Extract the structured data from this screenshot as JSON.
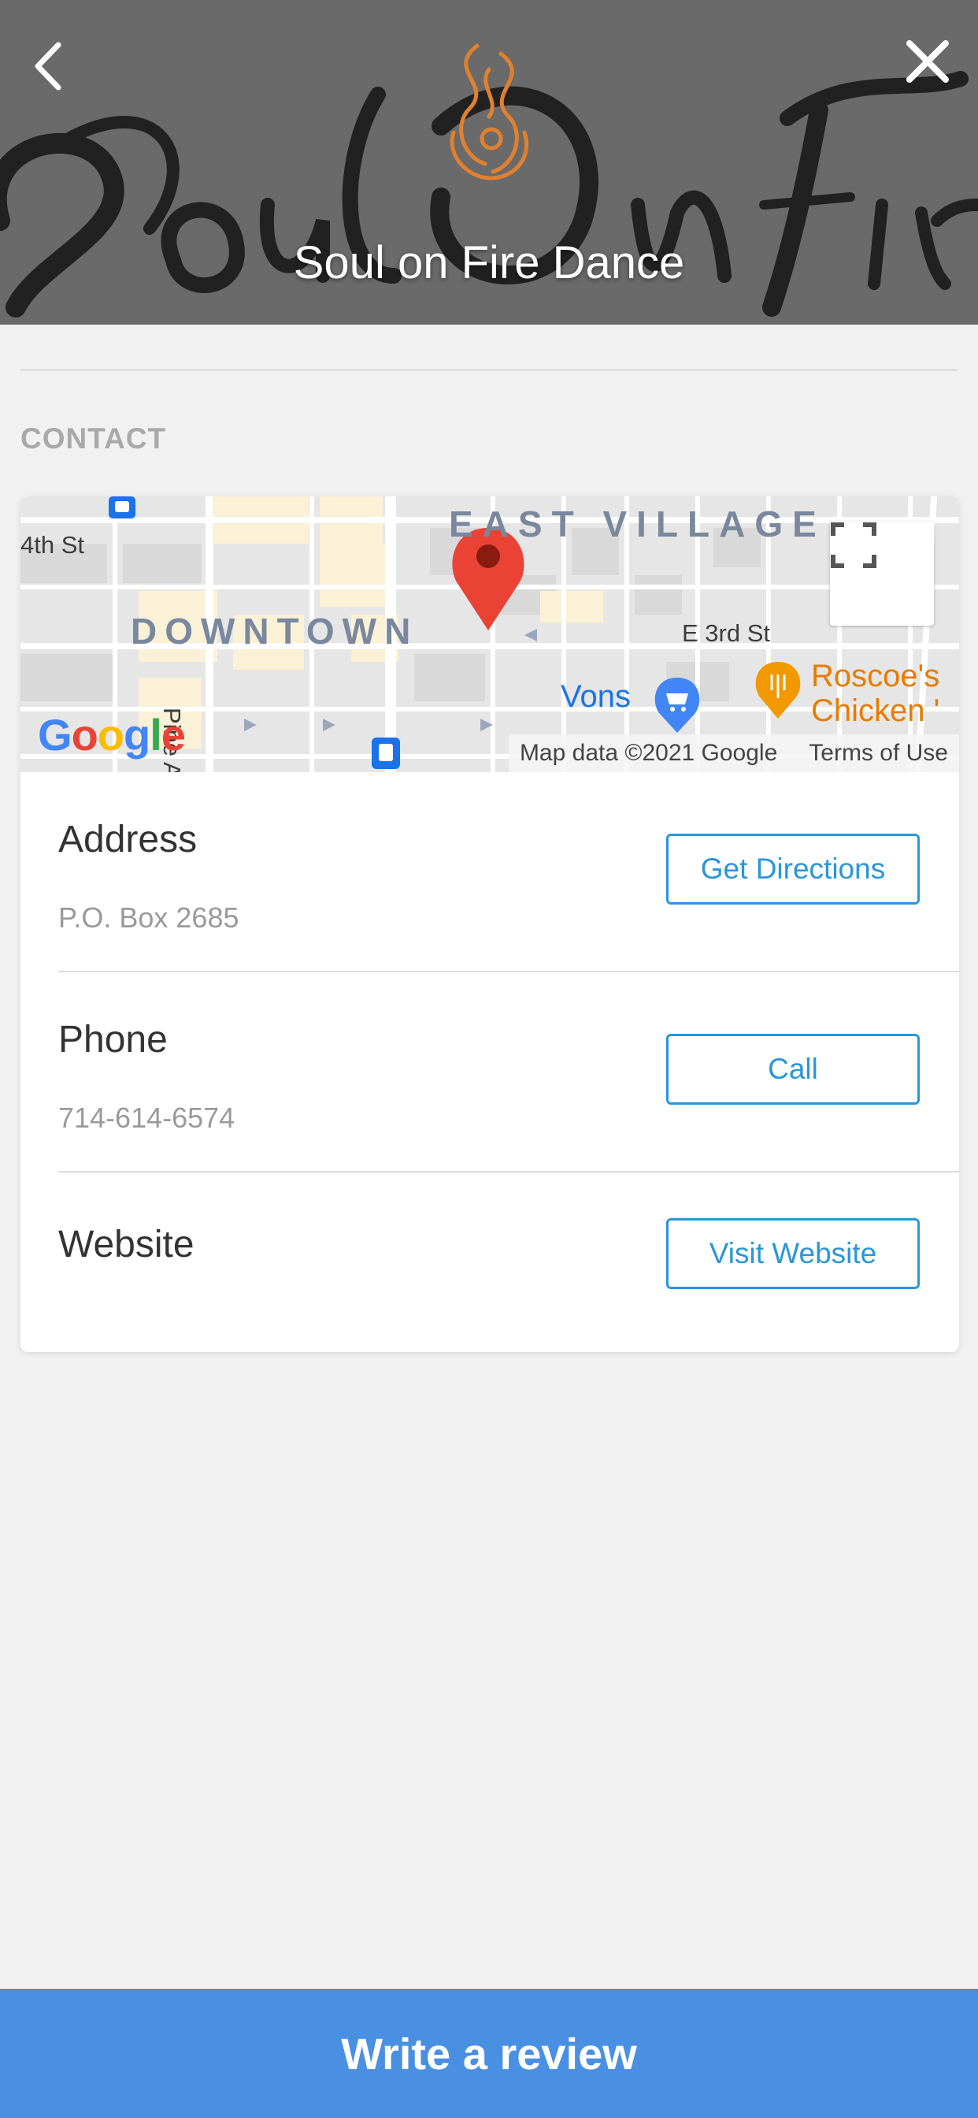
{
  "header": {
    "title": "Soul on Fire Dance",
    "back_icon": "chevron-left-icon",
    "close_icon": "close-icon",
    "logo": "flame-logo",
    "background_script": "Soul On Fire"
  },
  "contact": {
    "section_label": "CONTACT",
    "map": {
      "labels": {
        "east_village": "EAST VILLAGE",
        "downtown": "DOWNTOWN",
        "fourth_st": "4th St",
        "third_st": "E 3rd St",
        "pine": "Pine A",
        "vons": "Vons",
        "roscoe_1": "Roscoe's",
        "roscoe_2": "Chicken '",
        "third_right": "3rd"
      },
      "google_logo": "Google",
      "map_data": "Map data ©2021 Google",
      "terms": "Terms of Use",
      "fullscreen_icon": "fullscreen-icon"
    },
    "rows": [
      {
        "title": "Address",
        "value": "P.O. Box 2685",
        "button": "Get Directions"
      },
      {
        "title": "Phone",
        "value": "714-614-6574",
        "button": "Call"
      },
      {
        "title": "Website",
        "value": "",
        "button": "Visit Website"
      }
    ]
  },
  "cta": {
    "label": "Write a review"
  },
  "colors": {
    "accent": "#2a96d8",
    "cta_bg": "#4a90e2",
    "header_bg": "#6e6e6e",
    "page_bg": "#f1f1f1",
    "logo": "#e0812f"
  }
}
